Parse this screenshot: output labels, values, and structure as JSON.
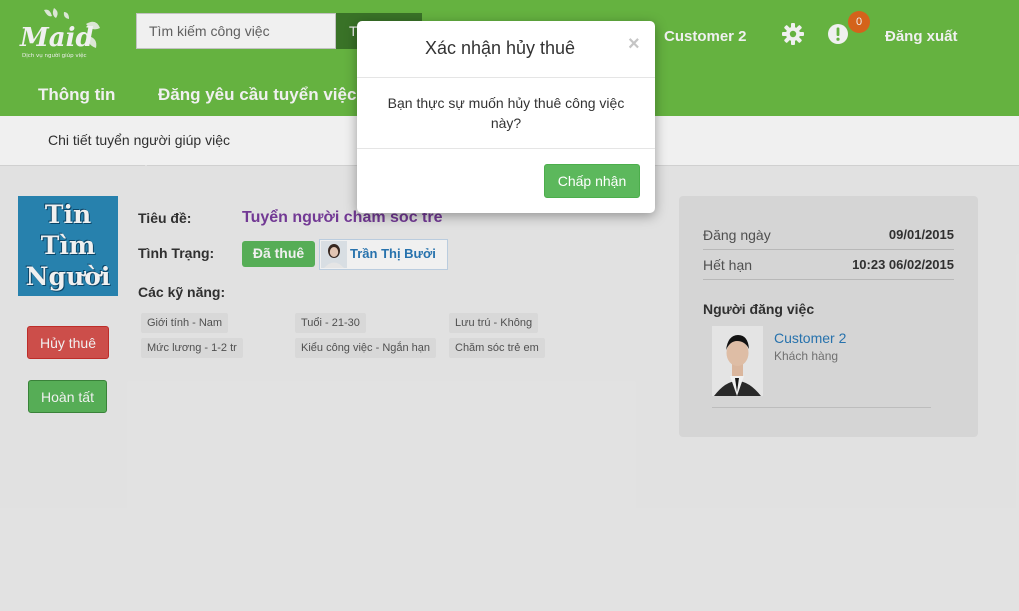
{
  "header": {
    "logo_text": "Maid",
    "logo_tagline": "Dịch vụ người giúp việc",
    "search": {
      "placeholder": "Tìm kiếm công việc",
      "button_label": "T"
    },
    "user_name": "Customer 2",
    "notification_count": "0",
    "logout_label": "Đăng xuất",
    "nav": [
      {
        "label": "Thông tin"
      },
      {
        "label": "Đăng yêu cầu tuyển việc"
      }
    ],
    "icons": {
      "settings": "gear-icon",
      "notifications": "alert-icon"
    }
  },
  "breadcrumb": "Chi tiết tuyển người giúp việc",
  "job": {
    "thumbnail_text": [
      "Tin",
      "Tìm",
      "Người"
    ],
    "title_label": "Tiêu đề:",
    "title": "Tuyển người chăm sóc trẻ",
    "status_label": "Tình Trạng:",
    "status": "Đã thuê",
    "worker_name": "Trần Thị Bưởi",
    "skills_label": "Các kỹ năng:",
    "skills": [
      "Giới tính - Nam",
      "Tuổi - 21-30",
      "Lưu trú - Không",
      "Mức lương - 1-2 tr",
      "Kiểu công việc - Ngắn hạn",
      "Chăm sóc trẻ em"
    ],
    "cancel_label": "Hủy thuê",
    "complete_label": "Hoàn tất"
  },
  "info": {
    "posted_label": "Đăng ngày",
    "posted_value": "09/01/2015",
    "expire_label": "Hết hạn",
    "expire_value": "10:23 06/02/2015",
    "poster_heading": "Người đăng việc",
    "poster_name": "Customer 2",
    "poster_role": "Khách hàng"
  },
  "modal": {
    "title": "Xác nhận hủy thuê",
    "close_symbol": "×",
    "body": "Bạn thực sự muốn hủy thuê công việc này?",
    "accept_label": "Chấp nhận"
  },
  "colors": {
    "header_green": "#6cbe45",
    "success": "#5cb85c",
    "danger": "#d9534f",
    "title_purple": "#7a3d9e",
    "link_blue": "#2a7ab8",
    "badge_orange": "#e26a1d"
  }
}
